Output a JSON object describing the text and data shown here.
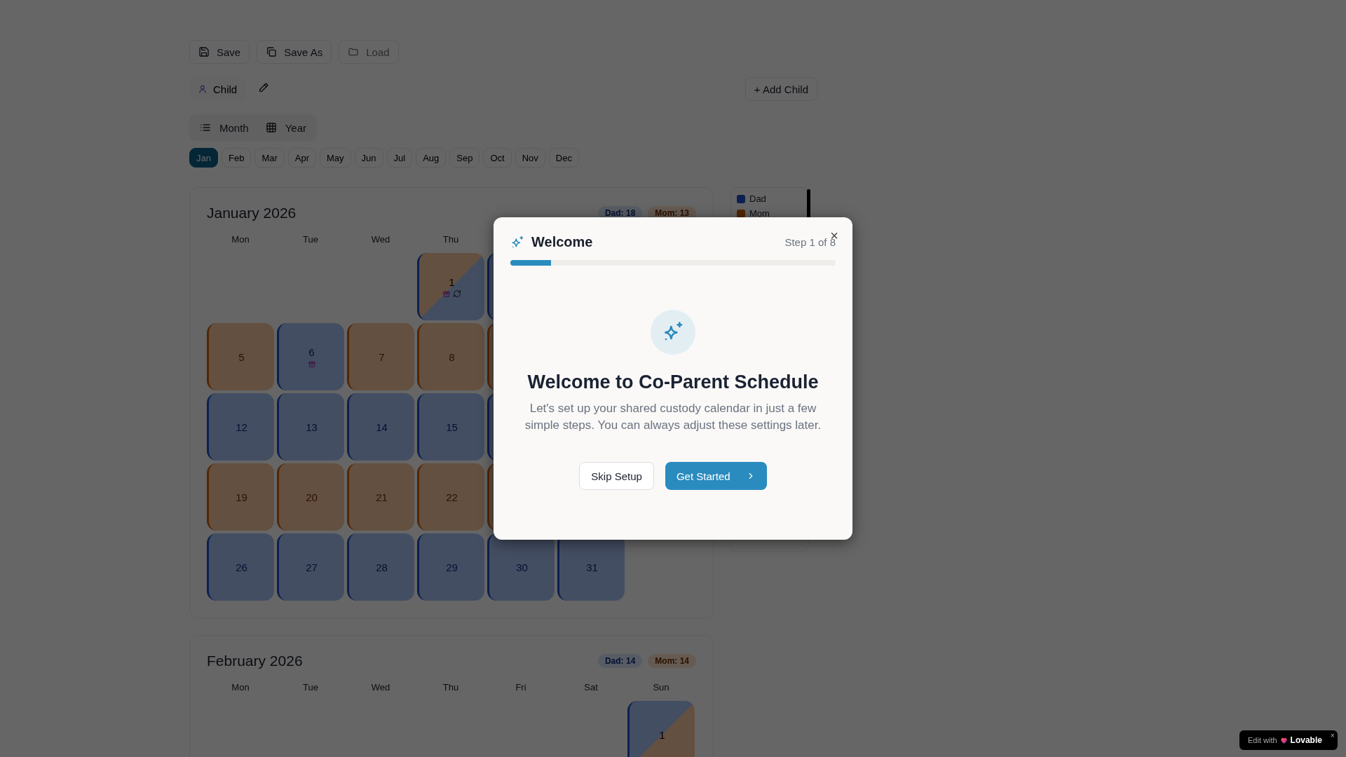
{
  "toolbar": [
    {
      "label": "Save",
      "disabled": false
    },
    {
      "label": "Save As",
      "disabled": false
    },
    {
      "label": "Load",
      "disabled": true
    }
  ],
  "child": {
    "label": "Child"
  },
  "add_child": {
    "label": "+ Add Child"
  },
  "view_toggle": [
    {
      "label": "Month"
    },
    {
      "label": "Year"
    }
  ],
  "months": [
    {
      "label": "Jan",
      "selected": true
    },
    {
      "label": "Feb",
      "selected": false
    },
    {
      "label": "Mar",
      "selected": false
    },
    {
      "label": "Apr",
      "selected": false
    },
    {
      "label": "May",
      "selected": false
    },
    {
      "label": "Jun",
      "selected": false
    },
    {
      "label": "Jul",
      "selected": false
    },
    {
      "label": "Aug",
      "selected": false
    },
    {
      "label": "Sep",
      "selected": false
    },
    {
      "label": "Oct",
      "selected": false
    },
    {
      "label": "Nov",
      "selected": false
    },
    {
      "label": "Dec",
      "selected": false
    }
  ],
  "calendars": [
    {
      "title": "January 2026",
      "badges": [
        {
          "kind": "dad",
          "label": "Dad: 18"
        },
        {
          "kind": "mom",
          "label": "Mom: 13"
        }
      ],
      "weekdays": [
        "Mon",
        "Tue",
        "Wed",
        "Thu"
      ],
      "cells": [
        {
          "kind": "split",
          "day": "1",
          "gift": true,
          "sync": true
        },
        {
          "kind": "dad"
        },
        {
          "kind": "blank"
        },
        {
          "kind": "blank"
        },
        {
          "kind": "mom",
          "day": "5"
        },
        {
          "kind": "dad",
          "day": "6",
          "gift": true
        },
        {
          "kind": "mom",
          "day": "7"
        },
        {
          "kind": "mom",
          "day": "8"
        },
        {
          "kind": "mom"
        },
        {
          "kind": "blank"
        },
        {
          "kind": "blank"
        },
        {
          "kind": "dad",
          "day": "12"
        },
        {
          "kind": "dad",
          "day": "13"
        },
        {
          "kind": "dad",
          "day": "14"
        },
        {
          "kind": "dad",
          "day": "15"
        },
        {
          "kind": "dad"
        },
        {
          "kind": "blank"
        },
        {
          "kind": "blank"
        },
        {
          "kind": "mom",
          "day": "19"
        },
        {
          "kind": "mom",
          "day": "20"
        },
        {
          "kind": "mom",
          "day": "21"
        },
        {
          "kind": "mom",
          "day": "22"
        },
        {
          "kind": "mom"
        },
        {
          "kind": "blank"
        },
        {
          "kind": "blank"
        },
        {
          "kind": "dad",
          "day": "26"
        },
        {
          "kind": "dad",
          "day": "27"
        },
        {
          "kind": "dad",
          "day": "28"
        },
        {
          "kind": "dad",
          "day": "29"
        },
        {
          "kind": "dad",
          "day": "30"
        },
        {
          "kind": "dad",
          "day": "31"
        }
      ]
    },
    {
      "title": "February 2026",
      "badges": [
        {
          "kind": "dad",
          "label": "Dad: 14"
        },
        {
          "kind": "mom",
          "label": "Mom: 14"
        }
      ],
      "weekdays": [
        "Mon",
        "Tue",
        "Wed",
        "Thu",
        "Fri",
        "Sat",
        "Sun"
      ],
      "cells": [
        {
          "kind": "split_reverse",
          "day": "1"
        }
      ]
    }
  ],
  "legend": [
    {
      "label": "Dad",
      "kind": "dad"
    },
    {
      "label": "Mom",
      "kind": "mom"
    }
  ],
  "modal": {
    "title": "Welcome",
    "step": "Step 1 of 8",
    "close": "×",
    "level": 0.125,
    "heading": "Welcome to Co-Parent Schedule",
    "description": "Let's set up your shared custody calendar in just a few simple steps. You can always adjust these settings later.",
    "secondary": "Skip Setup",
    "primary": "Get Started"
  },
  "lovable": {
    "prefix": "Edit with",
    "brand": "Lovable",
    "close": "×"
  }
}
